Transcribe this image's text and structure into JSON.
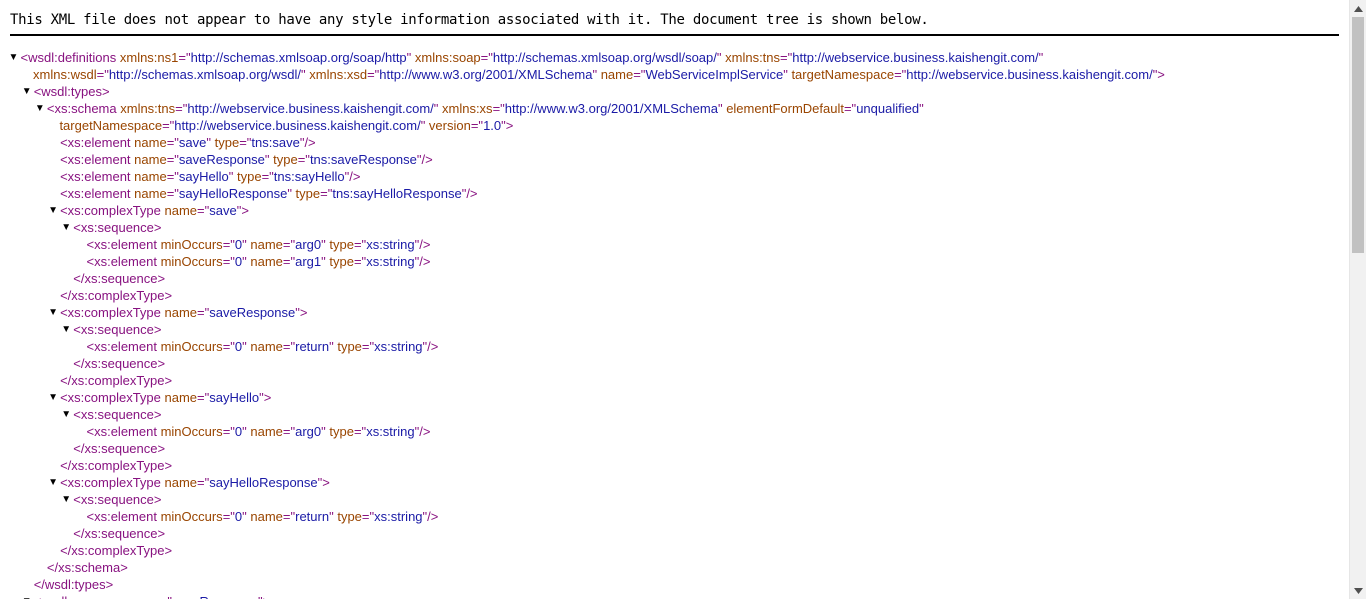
{
  "header_note": "This XML file does not appear to have any style information associated with it. The document tree is shown below.",
  "tree_lines": [
    {
      "indent": 0,
      "arrow": true,
      "parts": [
        {
          "c": "tag",
          "t": "<wsdl:definitions"
        },
        {
          "c": "an",
          "t": " xmlns:ns1"
        },
        {
          "c": "tag",
          "t": "=\""
        },
        {
          "c": "av",
          "t": "http://schemas.xmlsoap.org/soap/http"
        },
        {
          "c": "tag",
          "t": "\""
        },
        {
          "c": "an",
          "t": " xmlns:soap"
        },
        {
          "c": "tag",
          "t": "=\""
        },
        {
          "c": "av",
          "t": "http://schemas.xmlsoap.org/wsdl/soap/"
        },
        {
          "c": "tag",
          "t": "\""
        },
        {
          "c": "an",
          "t": " xmlns:tns"
        },
        {
          "c": "tag",
          "t": "=\""
        },
        {
          "c": "av",
          "t": "http://webservice.business.kaishengit.com/"
        },
        {
          "c": "tag",
          "t": "\""
        }
      ]
    },
    {
      "indent": 0.95,
      "arrow": false,
      "parts": [
        {
          "c": "an",
          "t": "xmlns:wsdl"
        },
        {
          "c": "tag",
          "t": "=\""
        },
        {
          "c": "av",
          "t": "http://schemas.xmlsoap.org/wsdl/"
        },
        {
          "c": "tag",
          "t": "\""
        },
        {
          "c": "an",
          "t": " xmlns:xsd"
        },
        {
          "c": "tag",
          "t": "=\""
        },
        {
          "c": "av",
          "t": "http://www.w3.org/2001/XMLSchema"
        },
        {
          "c": "tag",
          "t": "\""
        },
        {
          "c": "an",
          "t": " name"
        },
        {
          "c": "tag",
          "t": "=\""
        },
        {
          "c": "av",
          "t": "WebServiceImplService"
        },
        {
          "c": "tag",
          "t": "\""
        },
        {
          "c": "an",
          "t": " targetNamespace"
        },
        {
          "c": "tag",
          "t": "=\""
        },
        {
          "c": "av",
          "t": "http://webservice.business.kaishengit.com/"
        },
        {
          "c": "tag",
          "t": "\">"
        }
      ]
    },
    {
      "indent": 1,
      "arrow": true,
      "parts": [
        {
          "c": "tag",
          "t": "<wsdl:types>"
        }
      ]
    },
    {
      "indent": 2,
      "arrow": true,
      "parts": [
        {
          "c": "tag",
          "t": "<xs:schema"
        },
        {
          "c": "an",
          "t": " xmlns:tns"
        },
        {
          "c": "tag",
          "t": "=\""
        },
        {
          "c": "av",
          "t": "http://webservice.business.kaishengit.com/"
        },
        {
          "c": "tag",
          "t": "\""
        },
        {
          "c": "an",
          "t": " xmlns:xs"
        },
        {
          "c": "tag",
          "t": "=\""
        },
        {
          "c": "av",
          "t": "http://www.w3.org/2001/XMLSchema"
        },
        {
          "c": "tag",
          "t": "\""
        },
        {
          "c": "an",
          "t": " elementFormDefault"
        },
        {
          "c": "tag",
          "t": "=\""
        },
        {
          "c": "av",
          "t": "unqualified"
        },
        {
          "c": "tag",
          "t": "\""
        }
      ]
    },
    {
      "indent": 2.95,
      "arrow": false,
      "parts": [
        {
          "c": "an",
          "t": "targetNamespace"
        },
        {
          "c": "tag",
          "t": "=\""
        },
        {
          "c": "av",
          "t": "http://webservice.business.kaishengit.com/"
        },
        {
          "c": "tag",
          "t": "\""
        },
        {
          "c": "an",
          "t": " version"
        },
        {
          "c": "tag",
          "t": "=\""
        },
        {
          "c": "av",
          "t": "1.0"
        },
        {
          "c": "tag",
          "t": "\">"
        }
      ]
    },
    {
      "indent": 3,
      "arrow": false,
      "parts": [
        {
          "c": "tag",
          "t": "<xs:element"
        },
        {
          "c": "an",
          "t": " name"
        },
        {
          "c": "tag",
          "t": "=\""
        },
        {
          "c": "av",
          "t": "save"
        },
        {
          "c": "tag",
          "t": "\""
        },
        {
          "c": "an",
          "t": " type"
        },
        {
          "c": "tag",
          "t": "=\""
        },
        {
          "c": "av",
          "t": "tns:save"
        },
        {
          "c": "tag",
          "t": "\"/>"
        }
      ]
    },
    {
      "indent": 3,
      "arrow": false,
      "parts": [
        {
          "c": "tag",
          "t": "<xs:element"
        },
        {
          "c": "an",
          "t": " name"
        },
        {
          "c": "tag",
          "t": "=\""
        },
        {
          "c": "av",
          "t": "saveResponse"
        },
        {
          "c": "tag",
          "t": "\""
        },
        {
          "c": "an",
          "t": " type"
        },
        {
          "c": "tag",
          "t": "=\""
        },
        {
          "c": "av",
          "t": "tns:saveResponse"
        },
        {
          "c": "tag",
          "t": "\"/>"
        }
      ]
    },
    {
      "indent": 3,
      "arrow": false,
      "parts": [
        {
          "c": "tag",
          "t": "<xs:element"
        },
        {
          "c": "an",
          "t": " name"
        },
        {
          "c": "tag",
          "t": "=\""
        },
        {
          "c": "av",
          "t": "sayHello"
        },
        {
          "c": "tag",
          "t": "\""
        },
        {
          "c": "an",
          "t": " type"
        },
        {
          "c": "tag",
          "t": "=\""
        },
        {
          "c": "av",
          "t": "tns:sayHello"
        },
        {
          "c": "tag",
          "t": "\"/>"
        }
      ]
    },
    {
      "indent": 3,
      "arrow": false,
      "parts": [
        {
          "c": "tag",
          "t": "<xs:element"
        },
        {
          "c": "an",
          "t": " name"
        },
        {
          "c": "tag",
          "t": "=\""
        },
        {
          "c": "av",
          "t": "sayHelloResponse"
        },
        {
          "c": "tag",
          "t": "\""
        },
        {
          "c": "an",
          "t": " type"
        },
        {
          "c": "tag",
          "t": "=\""
        },
        {
          "c": "av",
          "t": "tns:sayHelloResponse"
        },
        {
          "c": "tag",
          "t": "\"/>"
        }
      ]
    },
    {
      "indent": 3,
      "arrow": true,
      "parts": [
        {
          "c": "tag",
          "t": "<xs:complexType"
        },
        {
          "c": "an",
          "t": " name"
        },
        {
          "c": "tag",
          "t": "=\""
        },
        {
          "c": "av",
          "t": "save"
        },
        {
          "c": "tag",
          "t": "\">"
        }
      ]
    },
    {
      "indent": 4,
      "arrow": true,
      "parts": [
        {
          "c": "tag",
          "t": "<xs:sequence>"
        }
      ]
    },
    {
      "indent": 5,
      "arrow": false,
      "parts": [
        {
          "c": "tag",
          "t": "<xs:element"
        },
        {
          "c": "an",
          "t": " minOccurs"
        },
        {
          "c": "tag",
          "t": "=\""
        },
        {
          "c": "av",
          "t": "0"
        },
        {
          "c": "tag",
          "t": "\""
        },
        {
          "c": "an",
          "t": " name"
        },
        {
          "c": "tag",
          "t": "=\""
        },
        {
          "c": "av",
          "t": "arg0"
        },
        {
          "c": "tag",
          "t": "\""
        },
        {
          "c": "an",
          "t": " type"
        },
        {
          "c": "tag",
          "t": "=\""
        },
        {
          "c": "av",
          "t": "xs:string"
        },
        {
          "c": "tag",
          "t": "\"/>"
        }
      ]
    },
    {
      "indent": 5,
      "arrow": false,
      "parts": [
        {
          "c": "tag",
          "t": "<xs:element"
        },
        {
          "c": "an",
          "t": " minOccurs"
        },
        {
          "c": "tag",
          "t": "=\""
        },
        {
          "c": "av",
          "t": "0"
        },
        {
          "c": "tag",
          "t": "\""
        },
        {
          "c": "an",
          "t": " name"
        },
        {
          "c": "tag",
          "t": "=\""
        },
        {
          "c": "av",
          "t": "arg1"
        },
        {
          "c": "tag",
          "t": "\""
        },
        {
          "c": "an",
          "t": " type"
        },
        {
          "c": "tag",
          "t": "=\""
        },
        {
          "c": "av",
          "t": "xs:string"
        },
        {
          "c": "tag",
          "t": "\"/>"
        }
      ]
    },
    {
      "indent": 4,
      "arrow": false,
      "parts": [
        {
          "c": "tag",
          "t": "</xs:sequence>"
        }
      ]
    },
    {
      "indent": 3,
      "arrow": false,
      "parts": [
        {
          "c": "tag",
          "t": "</xs:complexType>"
        }
      ]
    },
    {
      "indent": 3,
      "arrow": true,
      "parts": [
        {
          "c": "tag",
          "t": "<xs:complexType"
        },
        {
          "c": "an",
          "t": " name"
        },
        {
          "c": "tag",
          "t": "=\""
        },
        {
          "c": "av",
          "t": "saveResponse"
        },
        {
          "c": "tag",
          "t": "\">"
        }
      ]
    },
    {
      "indent": 4,
      "arrow": true,
      "parts": [
        {
          "c": "tag",
          "t": "<xs:sequence>"
        }
      ]
    },
    {
      "indent": 5,
      "arrow": false,
      "parts": [
        {
          "c": "tag",
          "t": "<xs:element"
        },
        {
          "c": "an",
          "t": " minOccurs"
        },
        {
          "c": "tag",
          "t": "=\""
        },
        {
          "c": "av",
          "t": "0"
        },
        {
          "c": "tag",
          "t": "\""
        },
        {
          "c": "an",
          "t": " name"
        },
        {
          "c": "tag",
          "t": "=\""
        },
        {
          "c": "av",
          "t": "return"
        },
        {
          "c": "tag",
          "t": "\""
        },
        {
          "c": "an",
          "t": " type"
        },
        {
          "c": "tag",
          "t": "=\""
        },
        {
          "c": "av",
          "t": "xs:string"
        },
        {
          "c": "tag",
          "t": "\"/>"
        }
      ]
    },
    {
      "indent": 4,
      "arrow": false,
      "parts": [
        {
          "c": "tag",
          "t": "</xs:sequence>"
        }
      ]
    },
    {
      "indent": 3,
      "arrow": false,
      "parts": [
        {
          "c": "tag",
          "t": "</xs:complexType>"
        }
      ]
    },
    {
      "indent": 3,
      "arrow": true,
      "parts": [
        {
          "c": "tag",
          "t": "<xs:complexType"
        },
        {
          "c": "an",
          "t": " name"
        },
        {
          "c": "tag",
          "t": "=\""
        },
        {
          "c": "av",
          "t": "sayHello"
        },
        {
          "c": "tag",
          "t": "\">"
        }
      ]
    },
    {
      "indent": 4,
      "arrow": true,
      "parts": [
        {
          "c": "tag",
          "t": "<xs:sequence>"
        }
      ]
    },
    {
      "indent": 5,
      "arrow": false,
      "parts": [
        {
          "c": "tag",
          "t": "<xs:element"
        },
        {
          "c": "an",
          "t": " minOccurs"
        },
        {
          "c": "tag",
          "t": "=\""
        },
        {
          "c": "av",
          "t": "0"
        },
        {
          "c": "tag",
          "t": "\""
        },
        {
          "c": "an",
          "t": " name"
        },
        {
          "c": "tag",
          "t": "=\""
        },
        {
          "c": "av",
          "t": "arg0"
        },
        {
          "c": "tag",
          "t": "\""
        },
        {
          "c": "an",
          "t": " type"
        },
        {
          "c": "tag",
          "t": "=\""
        },
        {
          "c": "av",
          "t": "xs:string"
        },
        {
          "c": "tag",
          "t": "\"/>"
        }
      ]
    },
    {
      "indent": 4,
      "arrow": false,
      "parts": [
        {
          "c": "tag",
          "t": "</xs:sequence>"
        }
      ]
    },
    {
      "indent": 3,
      "arrow": false,
      "parts": [
        {
          "c": "tag",
          "t": "</xs:complexType>"
        }
      ]
    },
    {
      "indent": 3,
      "arrow": true,
      "parts": [
        {
          "c": "tag",
          "t": "<xs:complexType"
        },
        {
          "c": "an",
          "t": " name"
        },
        {
          "c": "tag",
          "t": "=\""
        },
        {
          "c": "av",
          "t": "sayHelloResponse"
        },
        {
          "c": "tag",
          "t": "\">"
        }
      ]
    },
    {
      "indent": 4,
      "arrow": true,
      "parts": [
        {
          "c": "tag",
          "t": "<xs:sequence>"
        }
      ]
    },
    {
      "indent": 5,
      "arrow": false,
      "parts": [
        {
          "c": "tag",
          "t": "<xs:element"
        },
        {
          "c": "an",
          "t": " minOccurs"
        },
        {
          "c": "tag",
          "t": "=\""
        },
        {
          "c": "av",
          "t": "0"
        },
        {
          "c": "tag",
          "t": "\""
        },
        {
          "c": "an",
          "t": " name"
        },
        {
          "c": "tag",
          "t": "=\""
        },
        {
          "c": "av",
          "t": "return"
        },
        {
          "c": "tag",
          "t": "\""
        },
        {
          "c": "an",
          "t": " type"
        },
        {
          "c": "tag",
          "t": "=\""
        },
        {
          "c": "av",
          "t": "xs:string"
        },
        {
          "c": "tag",
          "t": "\"/>"
        }
      ]
    },
    {
      "indent": 4,
      "arrow": false,
      "parts": [
        {
          "c": "tag",
          "t": "</xs:sequence>"
        }
      ]
    },
    {
      "indent": 3,
      "arrow": false,
      "parts": [
        {
          "c": "tag",
          "t": "</xs:complexType>"
        }
      ]
    },
    {
      "indent": 2,
      "arrow": false,
      "parts": [
        {
          "c": "tag",
          "t": "</xs:schema>"
        }
      ]
    },
    {
      "indent": 1,
      "arrow": false,
      "parts": [
        {
          "c": "tag",
          "t": "</wsdl:types>"
        }
      ]
    },
    {
      "indent": 1,
      "arrow": true,
      "parts": [
        {
          "c": "tag",
          "t": "<wsdl:message"
        },
        {
          "c": "an",
          "t": " name"
        },
        {
          "c": "tag",
          "t": "=\""
        },
        {
          "c": "av",
          "t": "saveResponse"
        },
        {
          "c": "tag",
          "t": "\">"
        }
      ]
    }
  ],
  "arrow_glyph": "▼",
  "scrollbar": {
    "up_icon": "▲",
    "down_icon": "▼",
    "position_fraction": 0.0
  }
}
